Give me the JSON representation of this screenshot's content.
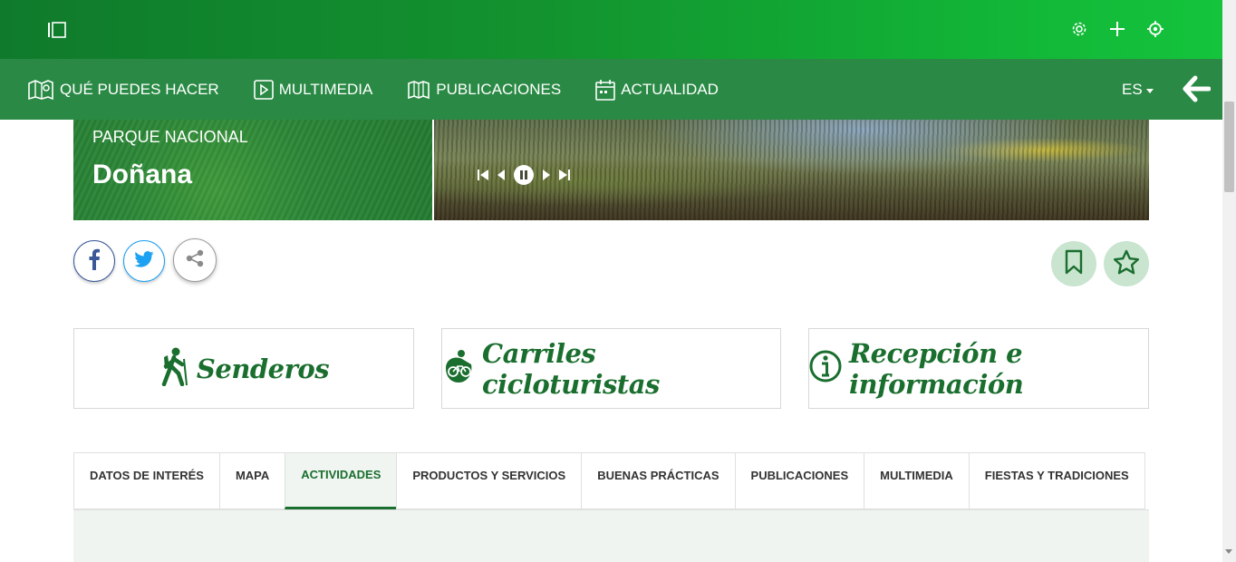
{
  "nav": {
    "items": [
      {
        "label": "QUÉ PUEDES HACER",
        "icon": "map-icon"
      },
      {
        "label": "MULTIMEDIA",
        "icon": "play-icon"
      },
      {
        "label": "PUBLICACIONES",
        "icon": "book-icon"
      },
      {
        "label": "ACTUALIDAD",
        "icon": "calendar-icon"
      }
    ],
    "language": "ES"
  },
  "hero": {
    "subtitle": "PARQUE NACIONAL",
    "title": "Doñana"
  },
  "cards": [
    {
      "label": "Senderos",
      "icon": "hiker-icon"
    },
    {
      "label": "Carriles cicloturistas",
      "icon": "bicycle-icon"
    },
    {
      "label": "Recepción e información",
      "icon": "info-icon"
    }
  ],
  "tabs": [
    {
      "label": "DATOS DE INTERÉS"
    },
    {
      "label": "MAPA"
    },
    {
      "label": "ACTIVIDADES",
      "active": true
    },
    {
      "label": "PRODUCTOS Y SERVICIOS"
    },
    {
      "label": "BUENAS PRÁCTICAS"
    },
    {
      "label": "PUBLICACIONES"
    },
    {
      "label": "MULTIMEDIA"
    },
    {
      "label": "FIESTAS Y TRADICIONES"
    }
  ],
  "colors": {
    "brand_green": "#1a6e2e",
    "nav_green": "#2a8a45",
    "facebook": "#3b5998",
    "twitter": "#1da1f2",
    "action_bg": "#c9e4cf"
  }
}
